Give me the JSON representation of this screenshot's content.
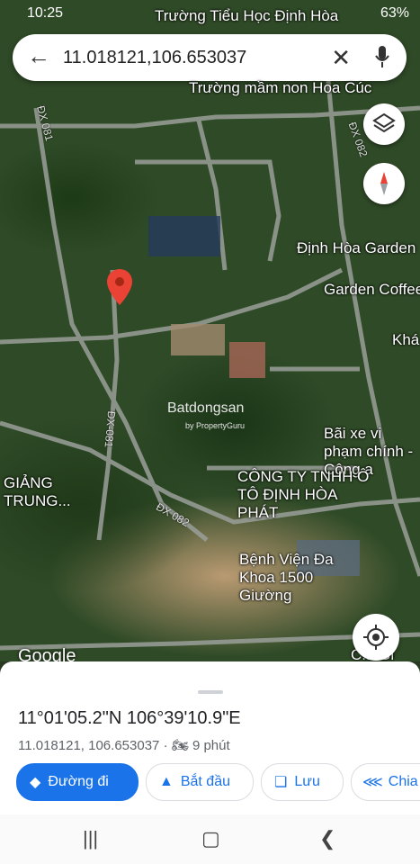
{
  "status_bar": {
    "time": "10:25",
    "battery": "63%"
  },
  "search": {
    "query": "11.018121,106.653037"
  },
  "map": {
    "places": [
      "Trường Tiểu Học Định Hòa",
      "Trường mầm non Hoa Cúc",
      "Định Hòa Garden",
      "Garden Coffee",
      "Khá",
      "Bãi xe vi phạm chính - Công a",
      "CÔNG TY TNHH Ô TÔ ĐỊNH HÒA PHÁT",
      "GIẢNG TRUNG...",
      "Bệnh Viện Đa Khoa 1500 Giường",
      "C... Gi"
    ],
    "roads": [
      "ĐX 081",
      "ĐX 082",
      "ĐX-081",
      "ĐX 082",
      "ĐX 081"
    ],
    "watermark": "Batdongsan",
    "watermark_sub": "by PropertyGuru",
    "google_logo": "Google"
  },
  "sheet": {
    "dms": "11°01'05.2\"N 106°39'10.9\"E",
    "decimal": "11.018121, 106.653037",
    "travel_time": "9 phút",
    "buttons": {
      "directions": "Đường đi",
      "start": "Bắt đầu",
      "save": "Lưu",
      "share": "Chia"
    }
  },
  "colors": {
    "accent": "#1a73e8",
    "pin": "#ea4335"
  }
}
